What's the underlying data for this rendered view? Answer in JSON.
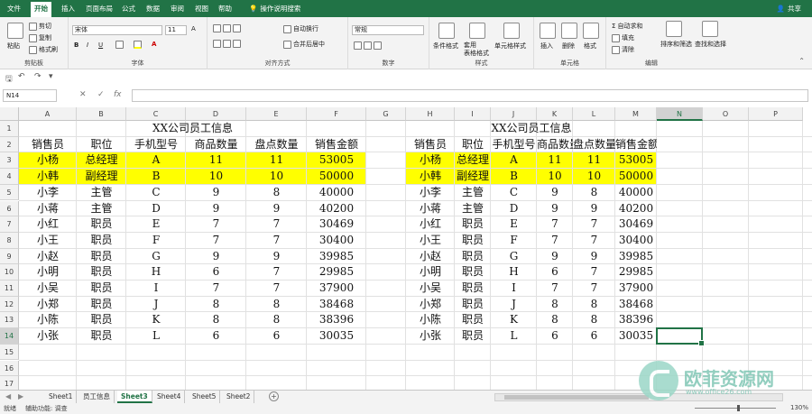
{
  "menubar": {
    "tabs": [
      "文件",
      "开始",
      "插入",
      "页面布局",
      "公式",
      "数据",
      "审阅",
      "视图",
      "帮助"
    ],
    "active_tab": "开始",
    "help_search": "操作说明搜索",
    "share": "共享",
    "brand_color": "#217346"
  },
  "ribbon": {
    "clipboard": {
      "paste": "粘贴",
      "cut": "剪切",
      "copy": "复制",
      "format_painter": "格式刷",
      "label": "剪贴板"
    },
    "font": {
      "name": "宋体",
      "size": "11",
      "label": "字体",
      "bold": "B",
      "italic": "I",
      "underline": "U"
    },
    "alignment": {
      "wrap": "自动换行",
      "merge": "合并后居中",
      "label": "对齐方式"
    },
    "number": {
      "format": "常规",
      "label": "数字"
    },
    "styles": {
      "conditional": "条件格式",
      "table": "套用\n表格格式",
      "cell": "单元格样式",
      "label": "样式"
    },
    "cells": {
      "insert": "插入",
      "delete": "删除",
      "format": "格式",
      "label": "单元格"
    },
    "editing": {
      "autosum": "自动求和",
      "fill": "填充",
      "clear": "清除",
      "sort": "排序和筛选",
      "find": "查找和选择",
      "label": "编辑"
    }
  },
  "formula_bar": {
    "name_box": "N14",
    "cancel": "✕",
    "enter": "✓",
    "fx": "fx",
    "value": ""
  },
  "grid": {
    "columns": [
      "A",
      "B",
      "C",
      "D",
      "E",
      "F",
      "G",
      "H",
      "I",
      "J",
      "K",
      "L",
      "M",
      "N",
      "O",
      "P"
    ],
    "rows": [
      "1",
      "2",
      "3",
      "4",
      "5",
      "6",
      "7",
      "8",
      "9",
      "10",
      "11",
      "12",
      "13",
      "14",
      "15",
      "16",
      "17"
    ],
    "selected_cell": "N14",
    "highlight_color": "#ffff00",
    "left_table": {
      "title": "XX公司员工信息",
      "headers": [
        "销售员",
        "职位",
        "手机型号",
        "商品数量",
        "盘点数量",
        "销售金额"
      ],
      "rows": [
        [
          "小杨",
          "总经理",
          "A",
          "11",
          "11",
          "53005"
        ],
        [
          "小韩",
          "副经理",
          "B",
          "10",
          "10",
          "50000"
        ],
        [
          "小李",
          "主管",
          "C",
          "9",
          "8",
          "40000"
        ],
        [
          "小蒋",
          "主管",
          "D",
          "9",
          "9",
          "40200"
        ],
        [
          "小红",
          "职员",
          "E",
          "7",
          "7",
          "30469"
        ],
        [
          "小王",
          "职员",
          "F",
          "7",
          "7",
          "30400"
        ],
        [
          "小赵",
          "职员",
          "G",
          "9",
          "9",
          "39985"
        ],
        [
          "小明",
          "职员",
          "H",
          "6",
          "7",
          "29985"
        ],
        [
          "小吴",
          "职员",
          "I",
          "7",
          "7",
          "37900"
        ],
        [
          "小郑",
          "职员",
          "J",
          "8",
          "8",
          "38468"
        ],
        [
          "小陈",
          "职员",
          "K",
          "8",
          "8",
          "38396"
        ],
        [
          "小张",
          "职员",
          "L",
          "6",
          "6",
          "30035"
        ]
      ]
    },
    "right_table": {
      "title": "XX公司员工信息",
      "headers": [
        "销售员",
        "职位",
        "手机型号",
        "商品数量",
        "盘点数量",
        "销售金额"
      ],
      "rows": [
        [
          "小杨",
          "总经理",
          "A",
          "11",
          "11",
          "53005"
        ],
        [
          "小韩",
          "副经理",
          "B",
          "10",
          "10",
          "50000"
        ],
        [
          "小李",
          "主管",
          "C",
          "9",
          "8",
          "40000"
        ],
        [
          "小蒋",
          "主管",
          "D",
          "9",
          "9",
          "40200"
        ],
        [
          "小红",
          "职员",
          "E",
          "7",
          "7",
          "30469"
        ],
        [
          "小王",
          "职员",
          "F",
          "7",
          "7",
          "30400"
        ],
        [
          "小赵",
          "职员",
          "G",
          "9",
          "9",
          "39985"
        ],
        [
          "小明",
          "职员",
          "H",
          "6",
          "7",
          "29985"
        ],
        [
          "小吴",
          "职员",
          "I",
          "7",
          "7",
          "37900"
        ],
        [
          "小郑",
          "职员",
          "J",
          "8",
          "8",
          "38468"
        ],
        [
          "小陈",
          "职员",
          "K",
          "8",
          "8",
          "38396"
        ],
        [
          "小张",
          "职员",
          "L",
          "6",
          "6",
          "30035"
        ]
      ]
    }
  },
  "sheets": {
    "tabs": [
      "Sheet1",
      "员工信息",
      "Sheet3",
      "Sheet4",
      "Sheet5",
      "Sheet2"
    ],
    "active": "Sheet3",
    "add": "+"
  },
  "status": {
    "ready": "就绪",
    "accessibility": "辅助功能: 调查",
    "zoom": "130%"
  },
  "watermark": {
    "name": "欧菲资源网",
    "url": "www.office26.com"
  }
}
